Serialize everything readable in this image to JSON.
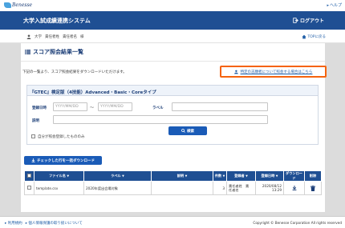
{
  "brand": {
    "logo_text": "Benesse"
  },
  "header": {
    "help_label": "ヘルプ",
    "system_title": "大学入試成績連携システム",
    "logout_label": "ログアウト"
  },
  "userbar": {
    "school": "大学",
    "position": "責任者姓",
    "name": "責任者名",
    "honorific": "様",
    "back_to_top": "TOPに戻る"
  },
  "page": {
    "title": "スコア照会結果一覧",
    "description": "下記の一覧より、スコア照会結果をダウンロードいただけます。",
    "callout_link": "特定の志願者について照会する場合はこちら"
  },
  "search_panel": {
    "title": "『GTEC』検定版（4技能）Advanced・Basic・Coreタイプ",
    "registered_at_label": "登録日時",
    "date_from_placeholder": "YYYY/MM/DD",
    "date_to_placeholder": "YYYY/MM/DD",
    "range_separator": "〜",
    "label_label": "ラベル",
    "note_label": "説明",
    "only_mine_label": "自分が照会登録したもののみ",
    "search_button": "検索"
  },
  "bulk_download_button": "チェックした行を一括ダウンロード",
  "table": {
    "columns": [
      "",
      "ファイル名",
      "ラベル",
      "説明",
      "件数",
      "登録者",
      "登録日時",
      "ダウンロード",
      "削除"
    ],
    "rows": [
      {
        "file_name": "template.csv",
        "label": "2020年度出会場対象",
        "note": "",
        "count": "3",
        "registrant_line1": "責任者姓　責",
        "registrant_line2": "任者名",
        "date": "2020/08/12",
        "time": "13:29"
      }
    ]
  },
  "footer": {
    "links": [
      "利用規約",
      "個人情報保護の取り扱いについて"
    ],
    "copyright": "Copyright © Benesse Corporation All rights reserved"
  },
  "colors": {
    "header_bg": "#1f4f93",
    "primary_button": "#1a5bb7",
    "callout_border": "#f5630d",
    "link": "#2260a8"
  }
}
